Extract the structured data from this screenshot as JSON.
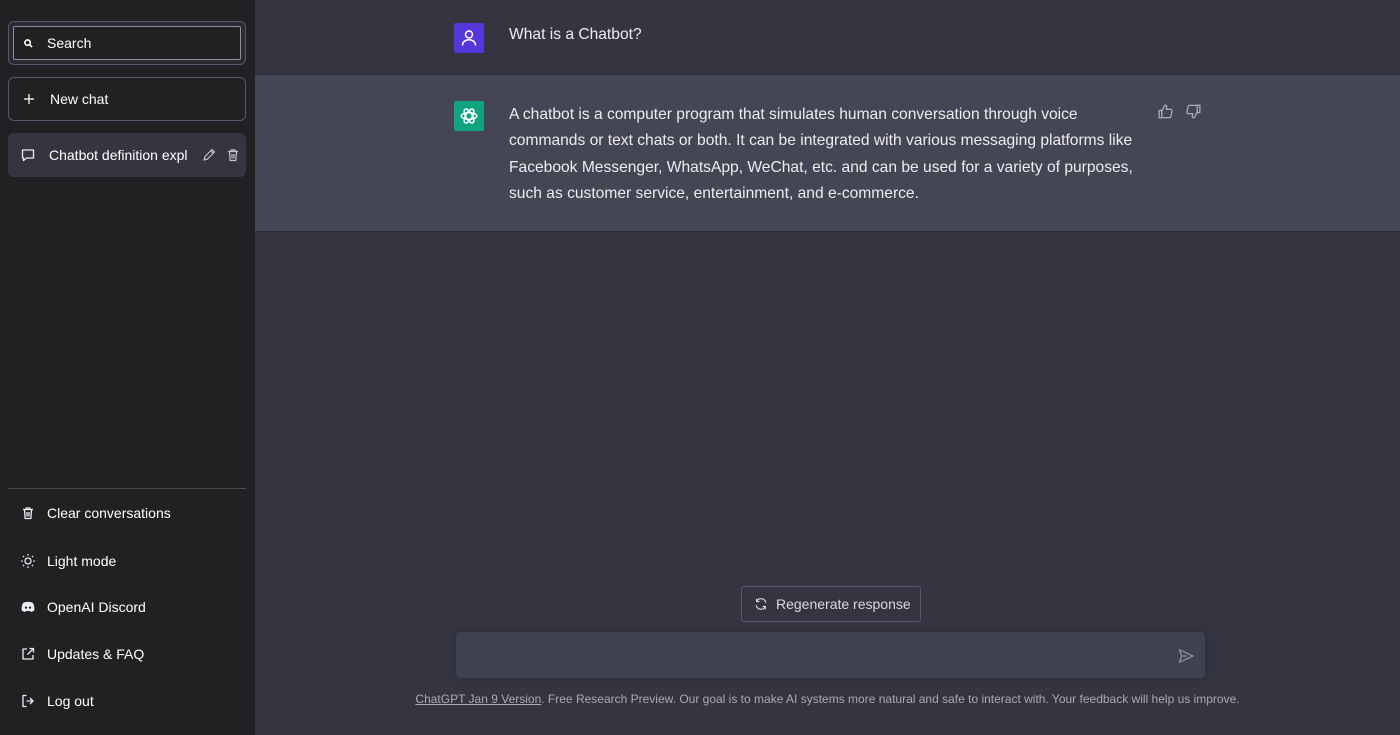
{
  "sidebar": {
    "search": {
      "placeholder": "Search",
      "value": ""
    },
    "new_chat_label": "New chat",
    "conversations": [
      {
        "title": "Chatbot definition expl"
      }
    ],
    "bottom_items": [
      {
        "label": "Clear conversations",
        "icon": "trash-icon"
      },
      {
        "label": "Light mode",
        "icon": "sun-icon"
      },
      {
        "label": "OpenAI Discord",
        "icon": "discord-icon"
      },
      {
        "label": "Updates & FAQ",
        "icon": "external-link-icon"
      },
      {
        "label": "Log out",
        "icon": "logout-icon"
      }
    ]
  },
  "thread": {
    "user_message": "What is a Chatbot?",
    "assistant_message": "A chatbot is a computer program that simulates human conversation through voice commands or text chats or both. It can be integrated with various messaging platforms like Facebook Messenger, WhatsApp, WeChat, etc. and can be used for a variety of purposes, such as customer service, entertainment, and e-commerce."
  },
  "regenerate_label": "Regenerate response",
  "composer": {
    "value": ""
  },
  "footer": {
    "link_text": "ChatGPT Jan 9 Version",
    "text": ". Free Research Preview. Our goal is to make AI systems more natural and safe to interact with. Your feedback will help us improve."
  },
  "colors": {
    "sidebar_bg": "#202123",
    "main_bg": "#343541",
    "assistant_bg": "#444654",
    "user_avatar": "#5436da",
    "bot_avatar": "#10a37f"
  }
}
